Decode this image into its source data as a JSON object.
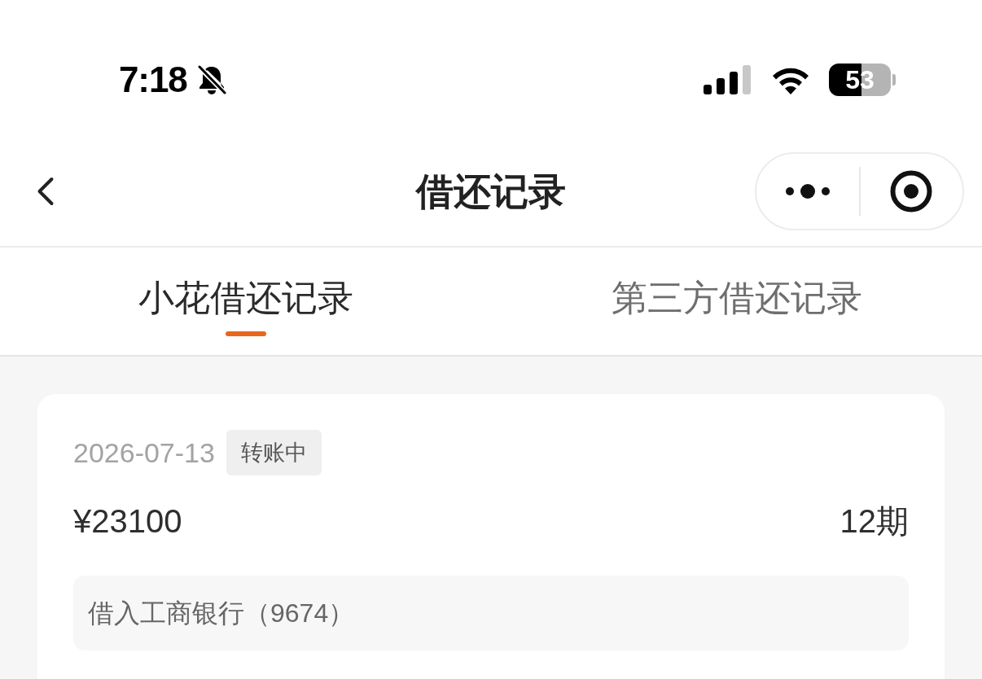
{
  "status_bar": {
    "time": "7:18",
    "battery": "53"
  },
  "nav_bar": {
    "title": "借还记录"
  },
  "tabs": [
    {
      "label": "小花借还记录",
      "selected": true
    },
    {
      "label": "第三方借还记录",
      "selected": false
    }
  ],
  "records": [
    {
      "date": "2026-07-13",
      "status": "转账中",
      "amount": "¥23100",
      "term": "12期",
      "account": "借入工商银行（9674）"
    }
  ]
}
